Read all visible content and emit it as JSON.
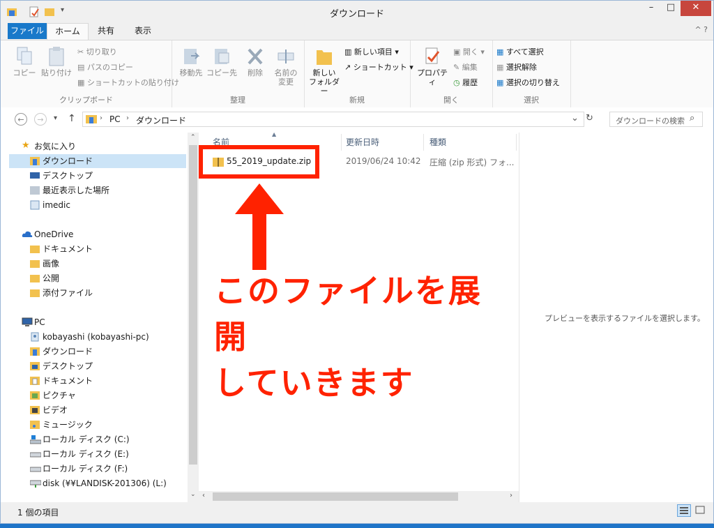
{
  "window": {
    "title": "ダウンロード"
  },
  "title_controls": {
    "minimize": "–",
    "maximize": "□",
    "close": "✕"
  },
  "tabs": {
    "file": "ファイル",
    "home": "ホーム",
    "share": "共有",
    "view": "表示",
    "help": "^ ?"
  },
  "ribbon": {
    "clipboard": {
      "label": "クリップボード",
      "copy": "コピー",
      "paste": "貼り付け",
      "cut": "切り取り",
      "copy_path": "パスのコピー",
      "paste_shortcut": "ショートカットの貼り付け"
    },
    "organize": {
      "label": "整理",
      "move_to": "移動先",
      "copy_to": "コピー先",
      "delete": "削除",
      "rename_line1": "名前の",
      "rename_line2": "変更"
    },
    "new": {
      "label": "新規",
      "new_folder_line1": "新しい",
      "new_folder_line2": "フォルダー",
      "new_item": "新しい項目 ▾",
      "shortcut": "ショートカット ▾"
    },
    "open": {
      "label": "開く",
      "properties": "プロパティ",
      "open": "開く ▾",
      "edit": "編集",
      "history": "履歴"
    },
    "select": {
      "label": "選択",
      "select_all": "すべて選択",
      "select_none": "選択解除",
      "invert": "選択の切り替え"
    }
  },
  "address": {
    "path": [
      "PC",
      "ダウンロード"
    ],
    "search_placeholder": "ダウンロードの検索",
    "nav_back": "←",
    "nav_forward": "→",
    "nav_recent": "▾",
    "nav_up": "↑",
    "addr_dropdown": "⌄",
    "refresh": "↻",
    "search_glyph": "⌕",
    "sep": "›"
  },
  "nav": {
    "favorites": "お気に入り",
    "fav_items": [
      "ダウンロード",
      "デスクトップ",
      "最近表示した場所",
      "imedic"
    ],
    "onedrive": "OneDrive",
    "onedrive_items": [
      "ドキュメント",
      "画像",
      "公開",
      "添付ファイル"
    ],
    "pc": "PC",
    "pc_items": [
      "kobayashi (kobayashi-pc)",
      "ダウンロード",
      "デスクトップ",
      "ドキュメント",
      "ピクチャ",
      "ビデオ",
      "ミュージック",
      "ローカル ディスク (C:)",
      "ローカル ディスク (E:)",
      "ローカル ディスク (F:)",
      "disk (¥¥LANDISK-201306) (L:)"
    ]
  },
  "files": {
    "columns": [
      "名前",
      "更新日時",
      "種類"
    ],
    "rows": [
      {
        "name": "55_2019_update.zip",
        "modified": "2019/06/24 10:42",
        "type": "圧縮 (zip 形式) フォ..."
      }
    ]
  },
  "preview": {
    "message": "プレビューを表示するファイルを選択します。"
  },
  "status": {
    "count": "1 個の項目"
  },
  "annotation": {
    "line1": "このファイルを展開",
    "line2": "していきます",
    "color": "#ff2200"
  },
  "colors": {
    "accent": "#1979ca",
    "folder": "#f2c14e"
  }
}
